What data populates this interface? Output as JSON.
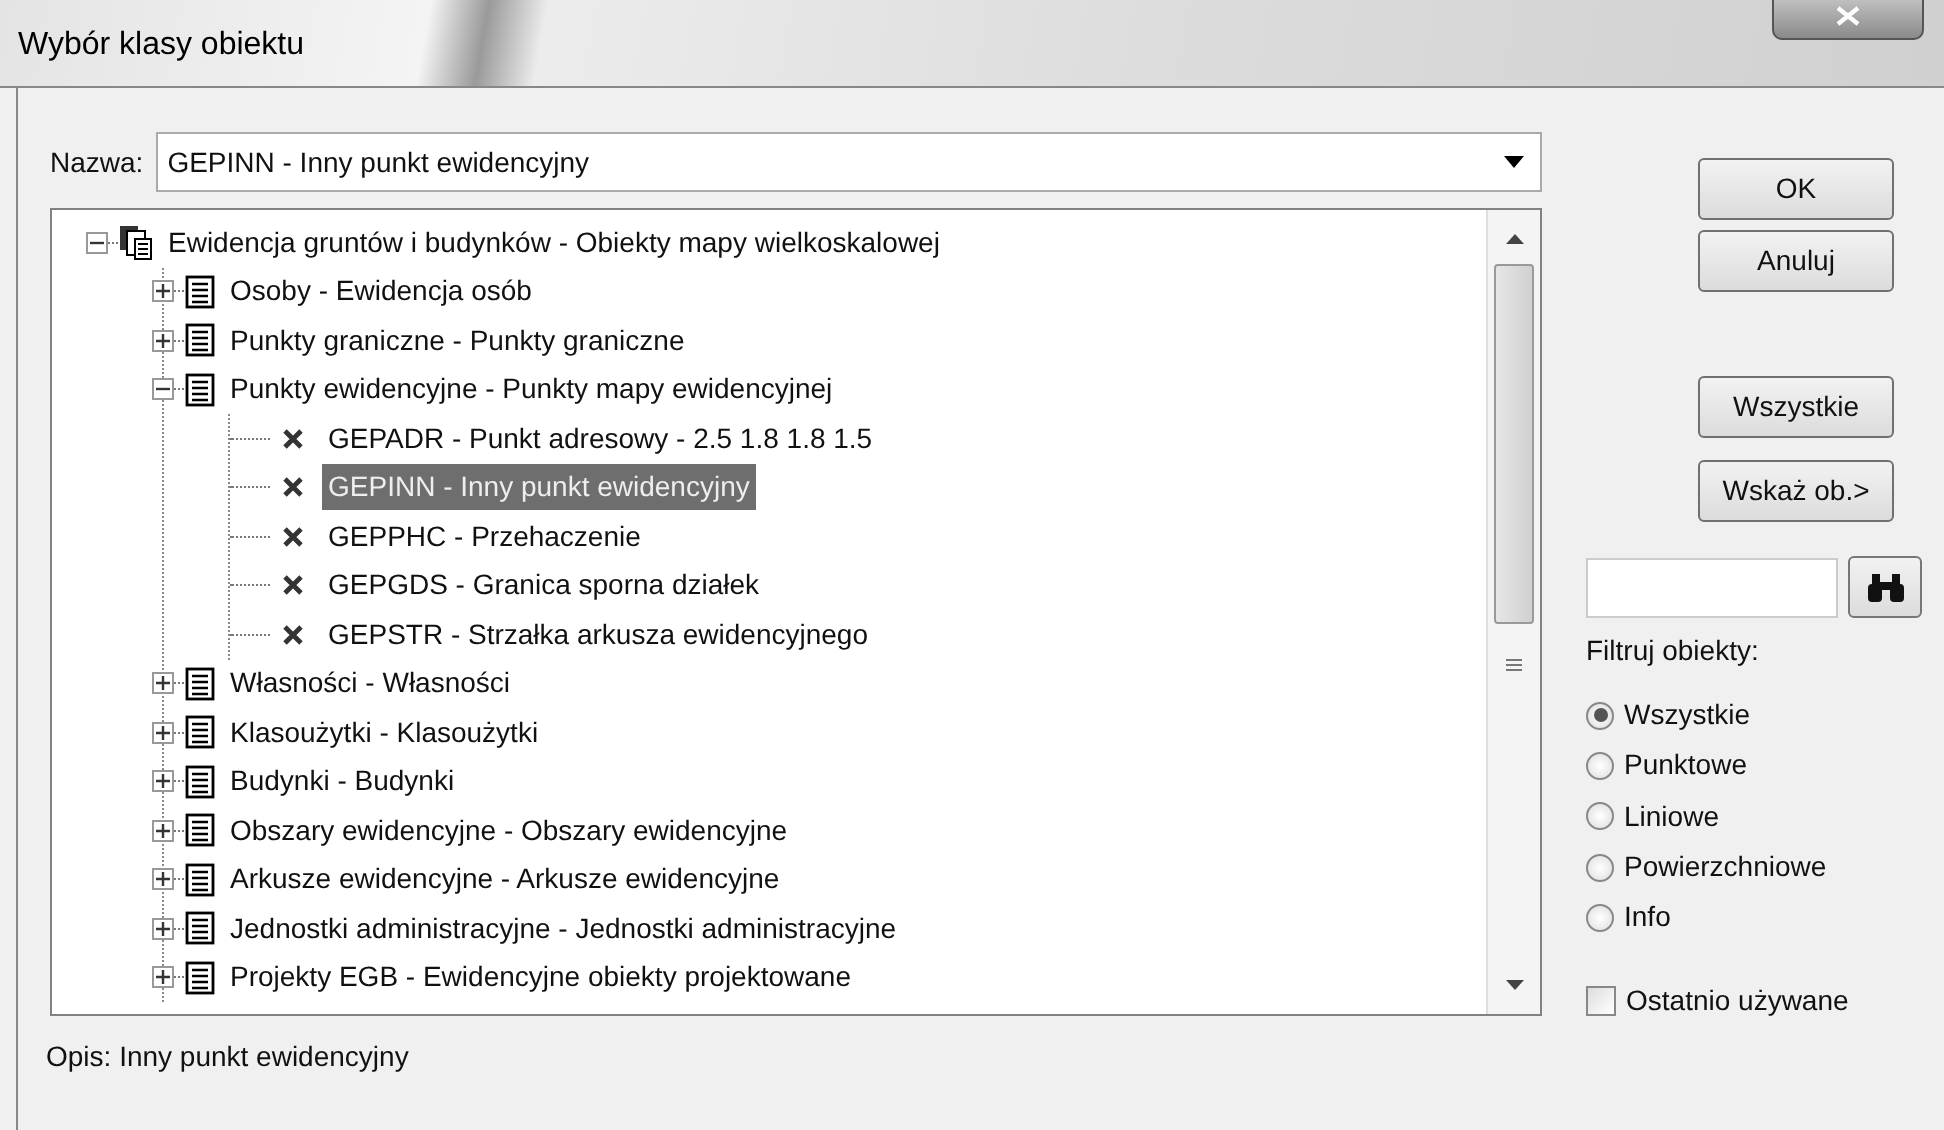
{
  "window": {
    "title": "Wybór klasy obiektu"
  },
  "name_field": {
    "label": "Nazwa:",
    "value": "GEPINN - Inny punkt ewidencyjny"
  },
  "tree": [
    {
      "label": "Ewidencja gruntów i budynków - Obiekty mapy wielkoskalowej",
      "kind": "root",
      "expanded": true,
      "selected": false,
      "children": [
        {
          "label": "Osoby - Ewidencja osób",
          "kind": "category",
          "expanded": false,
          "selected": false
        },
        {
          "label": "Punkty graniczne - Punkty graniczne",
          "kind": "category",
          "expanded": false,
          "selected": false
        },
        {
          "label": "Punkty ewidencyjne - Punkty mapy ewidencyjnej",
          "kind": "category",
          "expanded": true,
          "selected": false,
          "children": [
            {
              "label": "GEPADR - Punkt adresowy - 2.5 1.8 1.8 1.5",
              "kind": "item",
              "selected": false
            },
            {
              "label": "GEPINN - Inny punkt ewidencyjny",
              "kind": "item",
              "selected": true
            },
            {
              "label": "GEPPHC - Przehaczenie",
              "kind": "item",
              "selected": false
            },
            {
              "label": "GEPGDS - Granica sporna działek",
              "kind": "item",
              "selected": false
            },
            {
              "label": "GEPSTR - Strzałka arkusza ewidencyjnego",
              "kind": "item",
              "selected": false
            }
          ]
        },
        {
          "label": "Własności - Własności",
          "kind": "category",
          "expanded": false,
          "selected": false
        },
        {
          "label": "Klasoużytki - Klasoużytki",
          "kind": "category",
          "expanded": false,
          "selected": false
        },
        {
          "label": "Budynki - Budynki",
          "kind": "category",
          "expanded": false,
          "selected": false
        },
        {
          "label": "Obszary ewidencyjne - Obszary ewidencyjne",
          "kind": "category",
          "expanded": false,
          "selected": false
        },
        {
          "label": "Arkusze ewidencyjne - Arkusze ewidencyjne",
          "kind": "category",
          "expanded": false,
          "selected": false
        },
        {
          "label": "Jednostki administracyjne - Jednostki administracyjne",
          "kind": "category",
          "expanded": false,
          "selected": false
        },
        {
          "label": "Projekty EGB - Ewidencyjne obiekty projektowane",
          "kind": "category",
          "expanded": false,
          "selected": false
        }
      ]
    }
  ],
  "description": "Opis: Inny punkt ewidencyjny",
  "buttons": [
    {
      "label": "OK"
    },
    {
      "label": "Anuluj"
    },
    {
      "label": "Wszystkie"
    },
    {
      "label": "Wskaż ob.>"
    }
  ],
  "filter": {
    "label": "Filtruj obiekty:",
    "options": [
      {
        "label": "Wszystkie",
        "selected": true
      },
      {
        "label": "Punktowe",
        "selected": false
      },
      {
        "label": "Liniowe",
        "selected": false
      },
      {
        "label": "Powierzchniowe",
        "selected": false
      },
      {
        "label": "Info",
        "selected": false
      }
    ]
  },
  "recent": {
    "label": "Ostatnio używane",
    "checked": false
  }
}
